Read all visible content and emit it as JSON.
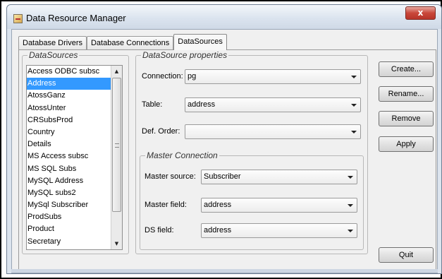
{
  "window": {
    "title": "Data Resource Manager",
    "close_glyph": "x"
  },
  "tabs": [
    {
      "label": "Database Drivers",
      "active": false
    },
    {
      "label": "Database Connections",
      "active": false
    },
    {
      "label": "DataSources",
      "active": true
    }
  ],
  "datasources": {
    "group_title": "DataSources",
    "items": [
      "Access ODBC subsc",
      "Address",
      "AtossGanz",
      "AtossUnter",
      "CRSubsProd",
      "Country",
      "Details",
      "MS Access subsc",
      "MS SQL Subs",
      "MySQL Address",
      "MySQL subs2",
      "MySql Subscriber",
      "ProdSubs",
      "Product",
      "Secretary"
    ],
    "selected": "Address"
  },
  "properties": {
    "group_title": "DataSource properties",
    "connection_label": "Connection:",
    "connection_value": "pg",
    "table_label": "Table:",
    "table_value": "address",
    "order_label": "Def. Order:",
    "order_value": ""
  },
  "master": {
    "group_title": "Master Connection",
    "source_label": "Master source:",
    "source_value": "Subscriber",
    "field_label": "Master field:",
    "field_value": "address",
    "ds_label": "DS field:",
    "ds_value": "address"
  },
  "buttons": {
    "create": "Create...",
    "rename": "Rename...",
    "remove": "Remove",
    "apply": "Apply",
    "quit": "Quit"
  },
  "colors": {
    "selection": "#3399ff",
    "close_button": "#c9473a"
  }
}
